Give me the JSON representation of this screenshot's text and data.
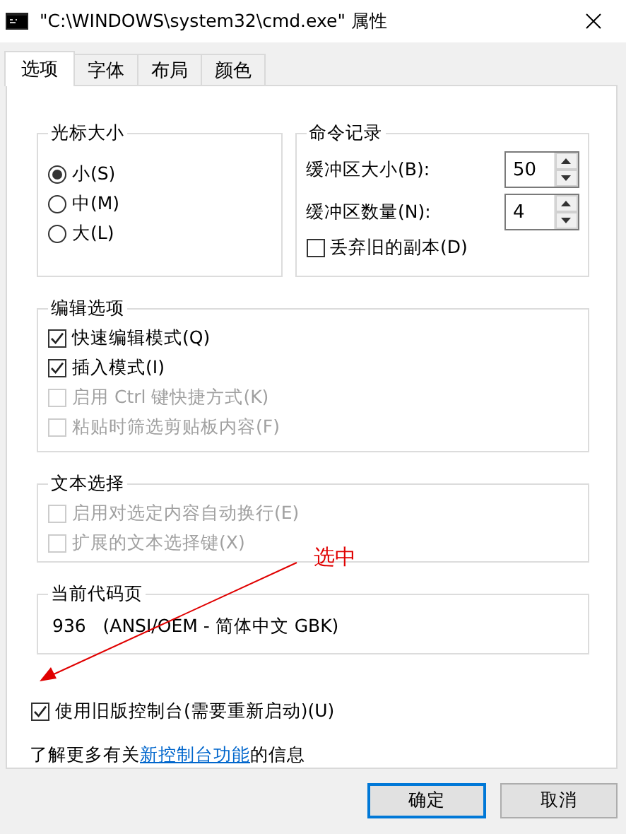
{
  "window": {
    "title": "\"C:\\WINDOWS\\system32\\cmd.exe\" 属性"
  },
  "tabs": [
    {
      "label": "选项",
      "selected": true
    },
    {
      "label": "字体",
      "selected": false
    },
    {
      "label": "布局",
      "selected": false
    },
    {
      "label": "颜色",
      "selected": false
    }
  ],
  "cursor_size": {
    "title": "光标大小",
    "options": [
      {
        "label": "小(S)",
        "selected": true
      },
      {
        "label": "中(M)",
        "selected": false
      },
      {
        "label": "大(L)",
        "selected": false
      }
    ]
  },
  "command_history": {
    "title": "命令记录",
    "fields": [
      {
        "label": "缓冲区大小(B):",
        "value": "50"
      },
      {
        "label": "缓冲区数量(N):",
        "value": "4"
      }
    ],
    "discard": {
      "label": "丢弃旧的副本(D)",
      "checked": false,
      "disabled": false
    }
  },
  "edit_options": {
    "title": "编辑选项",
    "items": [
      {
        "label": "快速编辑模式(Q)",
        "checked": true,
        "disabled": false
      },
      {
        "label": "插入模式(I)",
        "checked": true,
        "disabled": false
      },
      {
        "label": "启用 Ctrl 键快捷方式(K)",
        "checked": false,
        "disabled": true
      },
      {
        "label": "粘贴时筛选剪贴板内容(F)",
        "checked": false,
        "disabled": true
      }
    ]
  },
  "text_selection": {
    "title": "文本选择",
    "items": [
      {
        "label": "启用对选定内容自动换行(E)",
        "checked": false,
        "disabled": true
      },
      {
        "label": "扩展的文本选择键(X)",
        "checked": false,
        "disabled": true
      }
    ]
  },
  "code_page": {
    "title": "当前代码页",
    "value": "936   (ANSI/OEM - 简体中文 GBK)"
  },
  "legacy": {
    "label": "使用旧版控制台(需要重新启动)(U)",
    "checked": true,
    "disabled": false
  },
  "info": {
    "before": "了解更多有关",
    "link": "新控制台功能",
    "after": "的信息"
  },
  "annotation": {
    "text": "选中"
  },
  "buttons": [
    {
      "label": "确定",
      "default": true
    },
    {
      "label": "取消",
      "default": false
    }
  ]
}
